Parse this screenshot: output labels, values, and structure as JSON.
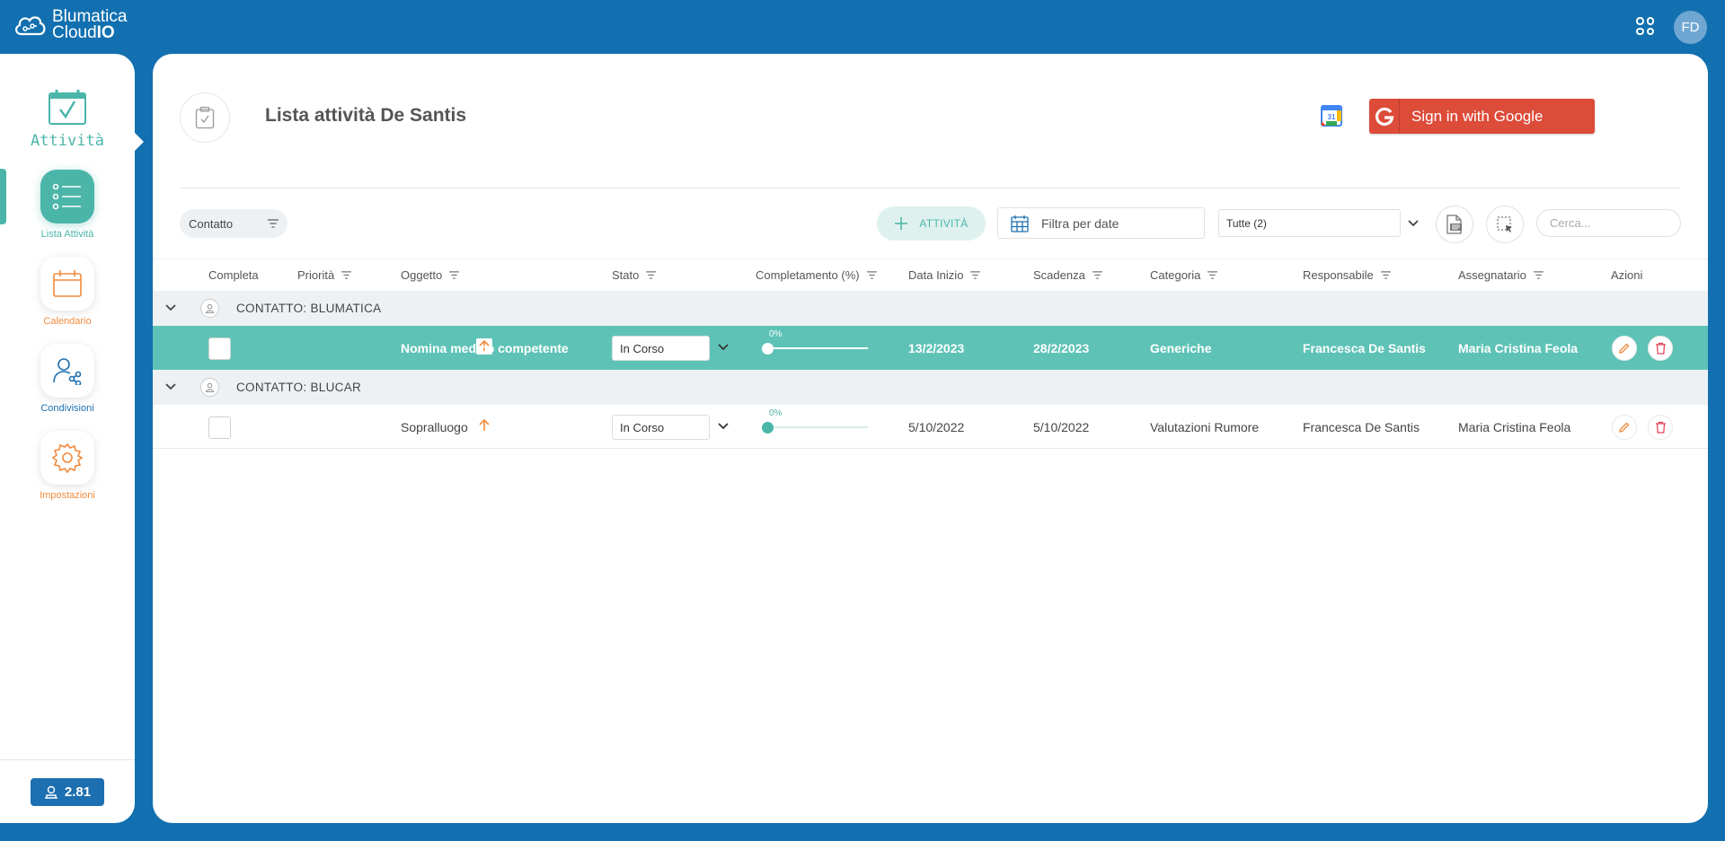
{
  "brand": {
    "line1": "Blumatica",
    "line2_prefix": "Cloud",
    "line2_bold": "IO"
  },
  "user": {
    "initials": "FD"
  },
  "sidebar": {
    "module_title": "Attività",
    "items": [
      {
        "label": "Lista Attività",
        "icon": "list-icon",
        "active": true
      },
      {
        "label": "Calendario",
        "icon": "calendar-icon",
        "active": false
      },
      {
        "label": "Condivisioni",
        "icon": "share-user-icon",
        "active": false
      },
      {
        "label": "Impostazioni",
        "icon": "gear-icon",
        "active": false
      }
    ],
    "version": "2.81"
  },
  "header": {
    "title": "Lista attività De Santis",
    "google_button": "Sign in with Google",
    "gcal_day": "31"
  },
  "toolbar": {
    "group_by": "Contatto",
    "add_label": "ATTIVITÀ",
    "date_filter": "Filtra per date",
    "select_value": "Tutte (2)",
    "search_placeholder": "Cerca..."
  },
  "table": {
    "columns": {
      "completa": "Completa",
      "priorita": "Priorità",
      "oggetto": "Oggetto",
      "stato": "Stato",
      "completamento": "Completamento (%)",
      "data_inizio": "Data Inizio",
      "scadenza": "Scadenza",
      "categoria": "Categoria",
      "responsabile": "Responsabile",
      "assegnatario": "Assegnatario",
      "azioni": "Azioni"
    },
    "groups": [
      {
        "label": "CONTATTO: BLUMATICA",
        "row": {
          "selected": true,
          "oggetto": "Nomina medico competente",
          "stato": "In Corso",
          "completamento": 0,
          "completamento_label": "0%",
          "data_inizio": "13/2/2023",
          "scadenza": "28/2/2023",
          "categoria": "Generiche",
          "responsabile": "Francesca De Santis",
          "assegnatario": "Maria Cristina Feola"
        }
      },
      {
        "label": "CONTATTO: BLUCAR",
        "row": {
          "selected": false,
          "oggetto": "Sopralluogo",
          "stato": "In Corso",
          "completamento": 0,
          "completamento_label": "0%",
          "data_inizio": "5/10/2022",
          "scadenza": "5/10/2022",
          "categoria": "Valutazioni Rumore",
          "responsabile": "Francesca De Santis",
          "assegnatario": "Maria Cristina Feola"
        }
      }
    ]
  },
  "colors": {
    "brand_blue": "#1270b0",
    "teal": "#4bb5a9",
    "selected_row": "#5ec3b6",
    "orange": "#f08a3c",
    "google_red": "#dd4b39",
    "delete_red": "#e2455a"
  }
}
